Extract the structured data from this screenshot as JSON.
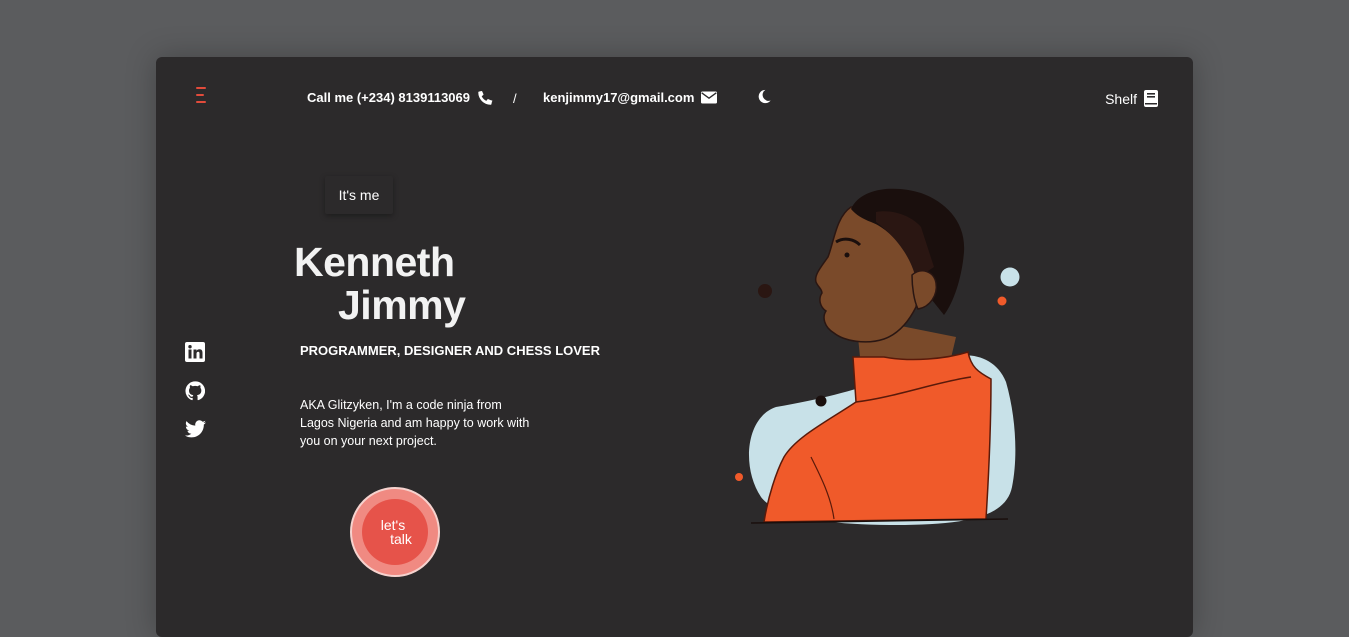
{
  "header": {
    "call_label": "Call me (+234) 8139113069",
    "separator": "/",
    "email": "kenjimmy17@gmail.com",
    "shelf_label": "Shelf"
  },
  "hero": {
    "badge": "It's me",
    "first_name": "Kenneth",
    "last_name": "Jimmy",
    "tagline": "PROGRAMMER, DESIGNER AND CHESS LOVER",
    "bio": "AKA Glitzyken, I'm a code ninja from Lagos Nigeria and am happy to work with you on your next project.",
    "cta_line1": "let's",
    "cta_line2": "talk"
  },
  "socials": [
    "linkedin-icon",
    "github-icon",
    "twitter-icon"
  ],
  "colors": {
    "accent": "#e6534a",
    "background": "#2c2a2b",
    "page": "#5b5c5e",
    "shirt": "#f05a2a",
    "blob": "#c8e1e8"
  }
}
